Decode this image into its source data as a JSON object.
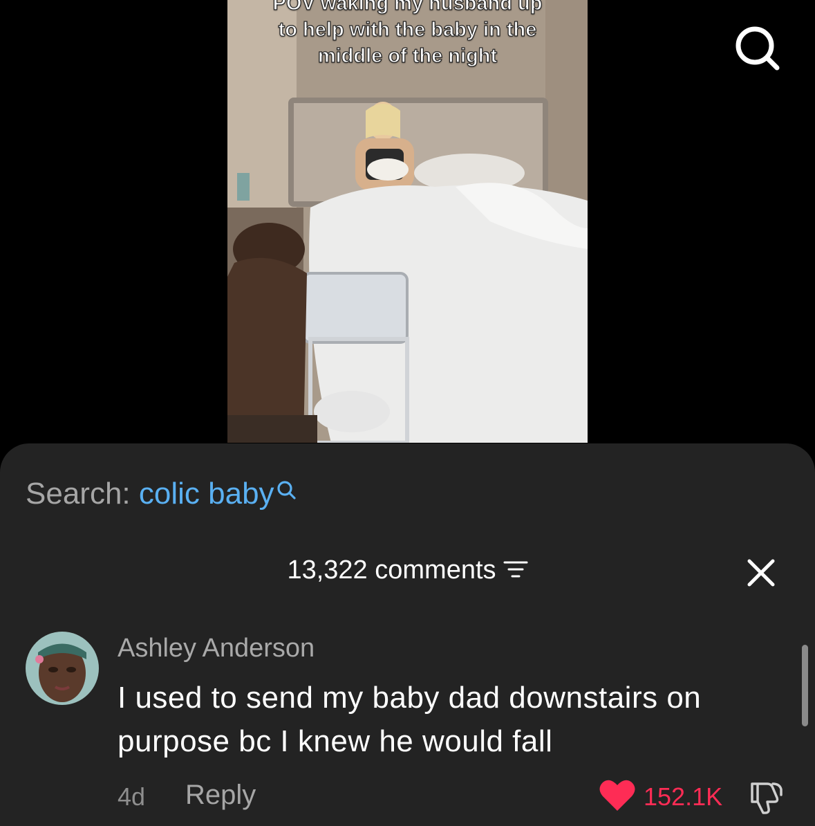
{
  "video": {
    "caption_lines": [
      "POV waking my husband up",
      "to help with the baby in the",
      "middle of the night"
    ]
  },
  "top_bar": {
    "search_icon": "search-icon"
  },
  "sheet": {
    "search_prefix": "Search:",
    "search_query": "colic baby",
    "comment_count_label": "13,322 comments",
    "filter_icon": "filter-icon",
    "close_icon": "close-icon"
  },
  "comment": {
    "username": "Ashley Anderson",
    "text": "I used to send my baby dad downstairs on purpose bc I knew he would fall",
    "age": "4d",
    "reply_label": "Reply",
    "like_count": "152.1K",
    "liked": true
  },
  "colors": {
    "accent_blue": "#5ab0f2",
    "like_red": "#fe2c55",
    "sheet_bg": "#232323"
  }
}
